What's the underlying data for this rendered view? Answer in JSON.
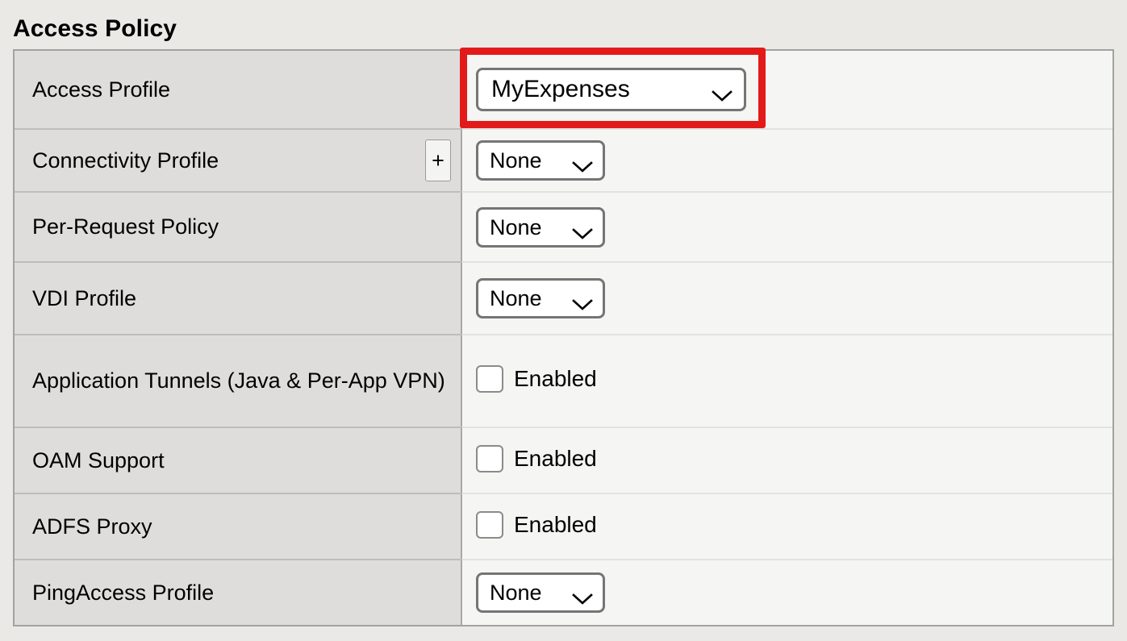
{
  "section": {
    "title": "Access Policy"
  },
  "rows": [
    {
      "id": "access-profile",
      "label": "Access Profile",
      "control": "select",
      "value": "MyExpenses",
      "has_plus": false,
      "highlighted": true
    },
    {
      "id": "connectivity-profile",
      "label": "Connectivity Profile",
      "control": "select",
      "value": "None",
      "has_plus": true,
      "plus_label": "+",
      "highlighted": false
    },
    {
      "id": "per-request-policy",
      "label": "Per-Request Policy",
      "control": "select",
      "value": "None",
      "has_plus": false,
      "highlighted": false
    },
    {
      "id": "vdi-profile",
      "label": "VDI Profile",
      "control": "select",
      "value": "None",
      "has_plus": false,
      "highlighted": false
    },
    {
      "id": "application-tunnels",
      "label": "Application Tunnels (Java & Per-App VPN)",
      "control": "checkbox",
      "value": "Enabled",
      "checked": false,
      "has_plus": false,
      "highlighted": false
    },
    {
      "id": "oam-support",
      "label": "OAM Support",
      "control": "checkbox",
      "value": "Enabled",
      "checked": false,
      "has_plus": false,
      "highlighted": false
    },
    {
      "id": "adfs-proxy",
      "label": "ADFS Proxy",
      "control": "checkbox",
      "value": "Enabled",
      "checked": false,
      "has_plus": false,
      "highlighted": false
    },
    {
      "id": "pingaccess-profile",
      "label": "PingAccess Profile",
      "control": "select",
      "value": "None",
      "has_plus": false,
      "highlighted": false
    }
  ],
  "icons": {
    "chevron_down": "chevron-down-icon",
    "plus": "plus-icon"
  },
  "colors": {
    "page_background": "#eae9e5",
    "label_cell_background": "#dedddb",
    "value_cell_background": "#f5f5f4",
    "table_border": "#a2a2a2",
    "highlight": "#e31a1a",
    "control_border": "#757575"
  }
}
